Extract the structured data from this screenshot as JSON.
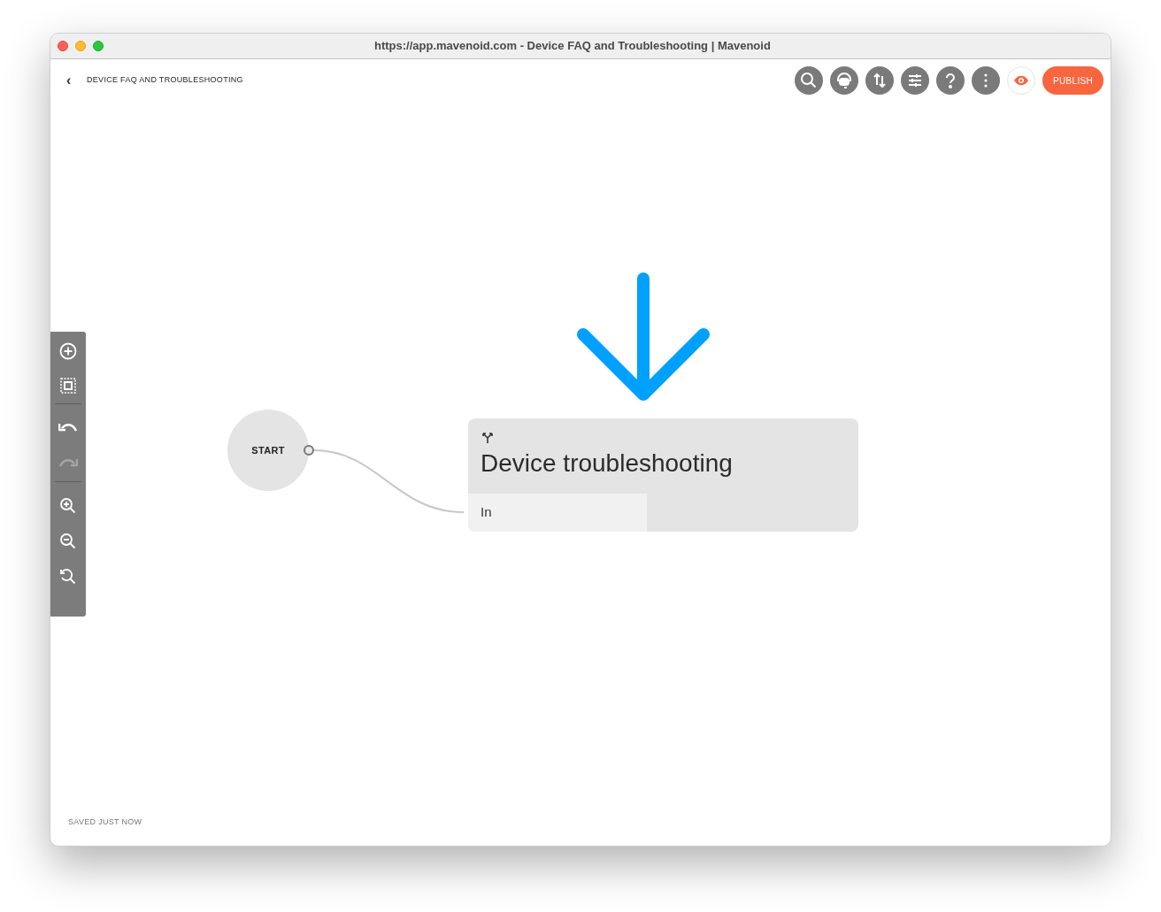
{
  "window": {
    "title": "https://app.mavenoid.com - Device FAQ and Troubleshooting | Mavenoid"
  },
  "header": {
    "back": "‹",
    "title": "DEVICE FAQ AND TROUBLESHOOTING",
    "publish": "PUBLISH"
  },
  "left_toolbar": {
    "undo_disabled": false,
    "redo_disabled": true
  },
  "canvas": {
    "start_node": {
      "label": "START"
    },
    "node": {
      "title": "Device troubleshooting",
      "ports": [
        {
          "label": "In"
        }
      ]
    }
  },
  "status_bar": {
    "text": "SAVED JUST NOW"
  }
}
